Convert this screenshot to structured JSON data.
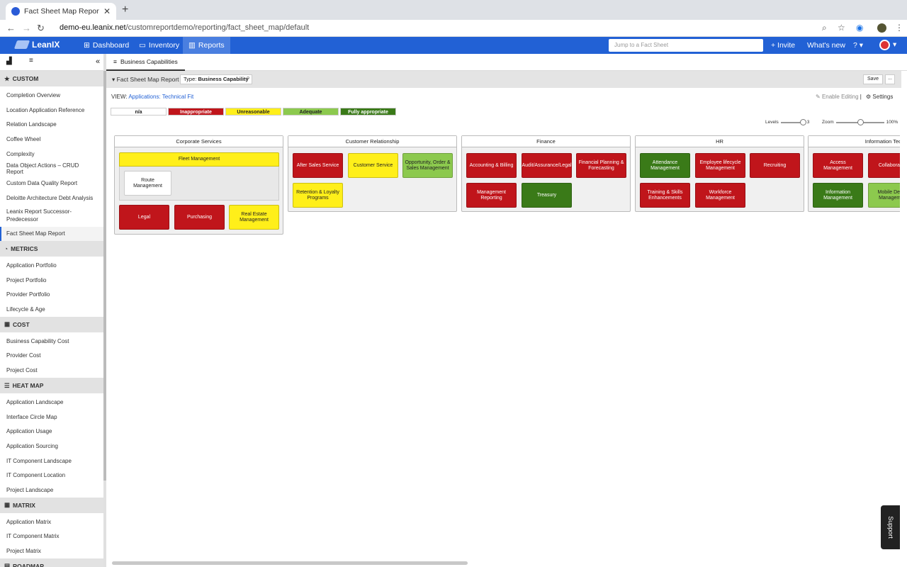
{
  "browser": {
    "tab_title": "Fact Sheet Map Report | LeanIX",
    "url_host": "demo-eu.leanix.net",
    "url_path": "/customreportdemo/reporting/fact_sheet_map/default"
  },
  "header": {
    "brand": "LeanIX",
    "nav": [
      "Dashboard",
      "Inventory",
      "Reports"
    ],
    "jump_placeholder": "Jump to a Fact Sheet",
    "invite": "+ Invite",
    "whats_new": "What's new"
  },
  "sidebar": {
    "sections": [
      {
        "title": "CUSTOM",
        "icon": "star-icon",
        "items": [
          "Completion Overview",
          "Location Application Reference",
          "Relation Landscape",
          "Coffee Wheel",
          "Complexity",
          "Data Object Actions – CRUD Report",
          "Custom Data Quality Report",
          "Deloitte Architecture Debt Analysis",
          "Leanix Report Successor-Predecessor",
          "Fact Sheet Map Report"
        ]
      },
      {
        "title": "METRICS",
        "icon": "gauge-icon",
        "items": [
          "Application Portfolio",
          "Project Portfolio",
          "Provider Portfolio",
          "Lifecycle & Age"
        ]
      },
      {
        "title": "COST",
        "icon": "bar-chart-icon",
        "items": [
          "Business Capability Cost",
          "Provider Cost",
          "Project Cost"
        ]
      },
      {
        "title": "HEAT MAP",
        "icon": "list-icon",
        "items": [
          "Application Landscape",
          "Interface Circle Map",
          "Application Usage",
          "Application Sourcing",
          "IT Component Landscape",
          "IT Component Location",
          "Project Landscape"
        ]
      },
      {
        "title": "MATRIX",
        "icon": "grid-icon",
        "items": [
          "Application Matrix",
          "IT Component Matrix",
          "Project Matrix"
        ]
      },
      {
        "title": "ROADMAP",
        "icon": "roadmap-icon",
        "items": []
      }
    ],
    "active_item": "Fact Sheet Map Report"
  },
  "subheader": {
    "tab": "Business Capabilities"
  },
  "toolbar": {
    "title": "Fact Sheet Map Report",
    "type_label": "Type:",
    "type_value": "Business Capability",
    "save": "Save",
    "more": "..."
  },
  "view": {
    "label": "VIEW:",
    "value": "Applications: Technical Fit",
    "enable_editing": "Enable Editing",
    "settings": "Settings"
  },
  "legend": [
    {
      "label": "n/a",
      "color": "#ffffff"
    },
    {
      "label": "Inappropriate",
      "color": "#c0151b"
    },
    {
      "label": "Unreasonable",
      "color": "#ffef1a"
    },
    {
      "label": "Adequate",
      "color": "#8cc94e"
    },
    {
      "label": "Fully appropriate",
      "color": "#3a7a18"
    }
  ],
  "controls": {
    "levels_label": "Levels",
    "levels_value": "3",
    "zoom_label": "Zoom",
    "zoom_value": "100%"
  },
  "groups": [
    {
      "title": "Corporate Services"
    },
    {
      "title": "Customer Relationship"
    },
    {
      "title": "Finance"
    },
    {
      "title": "HR"
    },
    {
      "title": "Information Technology"
    }
  ],
  "boxes": {
    "fleet": "Fleet Management",
    "route": "Route Management",
    "legal": "Legal",
    "purchasing": "Purchasing",
    "real_estate": "Real Estate Management",
    "after_sales": "After Sales Service",
    "customer_service": "Customer Service",
    "opportunity": "Opportunity, Order & Sales Management",
    "retention": "Retention & Loyalty Programs",
    "accounting": "Accounting & Billing",
    "audit": "Audit/Assurance/Legal",
    "financial_planning": "Financial Planning & Forecasting",
    "mgmt_reporting": "Management Reporting",
    "treasury": "Treasury",
    "attendance": "Attendance Management",
    "employee_lifecycle": "Employee lifecycle Management",
    "recruiting": "Recruiting",
    "training": "Training & Skills Enhancements",
    "workforce": "Workforce Management",
    "access": "Access Management",
    "collaboration": "Collaboration",
    "information": "Information Management",
    "mobile_device": "Mobile Device Management"
  },
  "support": "Support"
}
